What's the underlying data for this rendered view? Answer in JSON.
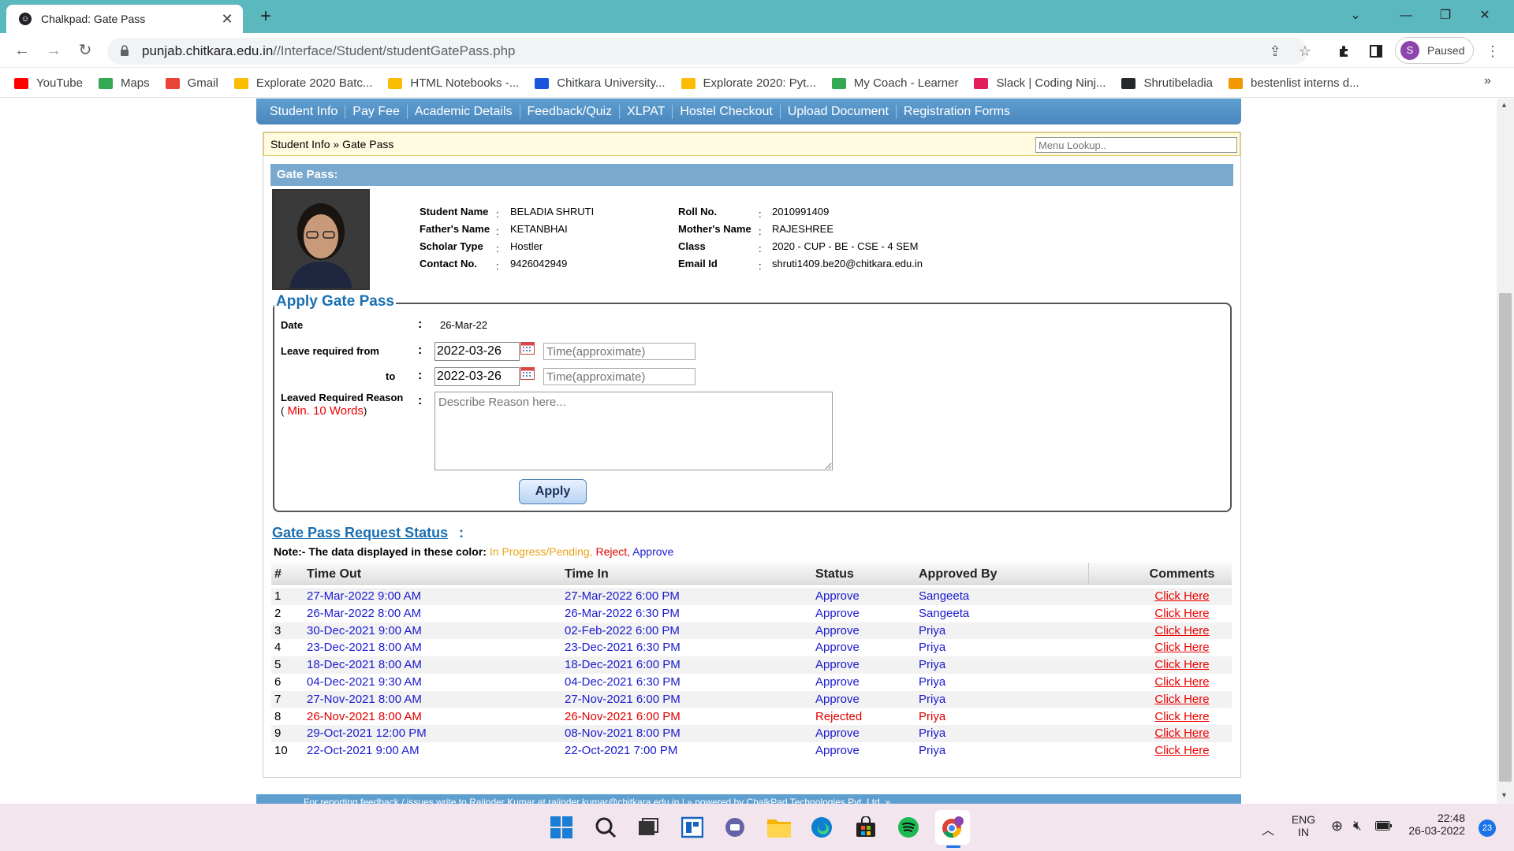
{
  "browser": {
    "tab_title": "Chalkpad: Gate Pass",
    "url_host": "punjab.chitkara.edu.in",
    "url_path": "//Interface/Student/studentGatePass.php",
    "profile_initial": "S",
    "profile_status": "Paused",
    "bookmarks": [
      {
        "label": "YouTube",
        "icon": "youtube-icon",
        "color": "#ff0000"
      },
      {
        "label": "Maps",
        "icon": "maps-icon",
        "color": "#34a853"
      },
      {
        "label": "Gmail",
        "icon": "gmail-icon",
        "color": "#ea4335"
      },
      {
        "label": "Explorate 2020 Batc...",
        "icon": "drive-icon",
        "color": "#fbbc04"
      },
      {
        "label": "HTML Notebooks -...",
        "icon": "drive-icon",
        "color": "#fbbc04"
      },
      {
        "label": "Chitkara University...",
        "icon": "chitkara-icon",
        "color": "#1a56db"
      },
      {
        "label": "Explorate 2020: Pyt...",
        "icon": "drive-icon",
        "color": "#fbbc04"
      },
      {
        "label": "My Coach - Learner",
        "icon": "coach-icon",
        "color": "#34a853"
      },
      {
        "label": "Slack | Coding Ninj...",
        "icon": "slack-icon",
        "color": "#e01e5a"
      },
      {
        "label": "Shrutibeladia",
        "icon": "github-icon",
        "color": "#24292e"
      },
      {
        "label": "bestenlist interns d...",
        "icon": "bookmark-icon",
        "color": "#f29900"
      }
    ]
  },
  "menu": [
    "Student Info",
    "Pay Fee",
    "Academic Details",
    "Feedback/Quiz",
    "XLPAT",
    "Hostel Checkout",
    "Upload Document",
    "Registration Forms"
  ],
  "breadcrumb": "Student Info » Gate Pass",
  "menu_lookup_placeholder": "Menu Lookup..",
  "gatepass_header": "Gate Pass:",
  "student": {
    "left": [
      {
        "label": "Student Name",
        "value": "BELADIA SHRUTI"
      },
      {
        "label": "Father's Name",
        "value": "KETANBHAI"
      },
      {
        "label": "Scholar Type",
        "value": "Hostler"
      },
      {
        "label": "Contact No.",
        "value": "9426042949"
      }
    ],
    "right": [
      {
        "label": "Roll No.",
        "value": "2010991409"
      },
      {
        "label": "Mother's Name",
        "value": "RAJESHREE"
      },
      {
        "label": "Class",
        "value": "2020 - CUP - BE - CSE - 4 SEM"
      },
      {
        "label": "Email Id",
        "value": "shruti1409.be20@chitkara.edu.in"
      }
    ]
  },
  "form": {
    "legend": "Apply Gate Pass",
    "date_label": "Date",
    "date_value": "26-Mar-22",
    "from_label": "Leave required from",
    "from_date": "2022-03-26",
    "to_label": "to",
    "to_date": "2022-03-26",
    "time_placeholder": "Time(approximate)",
    "reason_label": "Leaved Required Reason",
    "reason_hint_open": "(",
    "reason_hint": "Min. 10 Words",
    "reason_hint_close": ")",
    "reason_placeholder": "Describe Reason here...",
    "apply_label": "Apply"
  },
  "status": {
    "title": "Gate Pass Request Status",
    "colon": ":",
    "note_prefix": "Note:- The data displayed in these color:",
    "note_pending": "In Progress/Pending,",
    "note_reject": "Reject,",
    "note_approve": "Approve",
    "colors": {
      "pending": "#e8a317",
      "reject": "#e00000",
      "approve": "#1a1ad0"
    },
    "columns": [
      "#",
      "Time Out",
      "Time In",
      "Status",
      "Approved By",
      "Comments"
    ],
    "rows": [
      {
        "n": "1",
        "out": "27-Mar-2022 9:00 AM",
        "in": "27-Mar-2022 6:00 PM",
        "status": "Approve",
        "by": "Sangeeta",
        "comment": "Click Here",
        "state": "approve"
      },
      {
        "n": "2",
        "out": "26-Mar-2022 8:00 AM",
        "in": "26-Mar-2022 6:30 PM",
        "status": "Approve",
        "by": "Sangeeta",
        "comment": "Click Here",
        "state": "approve"
      },
      {
        "n": "3",
        "out": "30-Dec-2021 9:00 AM",
        "in": "02-Feb-2022 6:00 PM",
        "status": "Approve",
        "by": "Priya",
        "comment": "Click Here",
        "state": "approve"
      },
      {
        "n": "4",
        "out": "23-Dec-2021 8:00 AM",
        "in": "23-Dec-2021 6:30 PM",
        "status": "Approve",
        "by": "Priya",
        "comment": "Click Here",
        "state": "approve"
      },
      {
        "n": "5",
        "out": "18-Dec-2021 8:00 AM",
        "in": "18-Dec-2021 6:00 PM",
        "status": "Approve",
        "by": "Priya",
        "comment": "Click Here",
        "state": "approve"
      },
      {
        "n": "6",
        "out": "04-Dec-2021 9:30 AM",
        "in": "04-Dec-2021 6:30 PM",
        "status": "Approve",
        "by": "Priya",
        "comment": "Click Here",
        "state": "approve"
      },
      {
        "n": "7",
        "out": "27-Nov-2021 8:00 AM",
        "in": "27-Nov-2021 6:00 PM",
        "status": "Approve",
        "by": "Priya",
        "comment": "Click Here",
        "state": "approve"
      },
      {
        "n": "8",
        "out": "26-Nov-2021 8:00 AM",
        "in": "26-Nov-2021 6:00 PM",
        "status": "Rejected",
        "by": "Priya",
        "comment": "Click Here",
        "state": "reject"
      },
      {
        "n": "9",
        "out": "29-Oct-2021 12:00 PM",
        "in": "08-Nov-2021 8:00 PM",
        "status": "Approve",
        "by": "Priya",
        "comment": "Click Here",
        "state": "approve"
      },
      {
        "n": "10",
        "out": "22-Oct-2021 9:00 AM",
        "in": "22-Oct-2021 7:00 PM",
        "status": "Approve",
        "by": "Priya",
        "comment": "Click Here",
        "state": "approve"
      }
    ]
  },
  "footer_text": "For reporting feedback / issues write to Rajinder Kumar at rajinder.kumar@chitkara.edu.in | » powered by ChalkPad Technologies Pvt. Ltd. »",
  "taskbar": {
    "apps": [
      "windows-start-icon",
      "search-icon",
      "task-view-icon",
      "widgets-icon",
      "teams-chat-icon",
      "file-explorer-icon",
      "edge-icon",
      "store-icon",
      "spotify-icon",
      "chrome-icon"
    ],
    "lang_top": "ENG",
    "lang_bottom": "IN",
    "time": "22:48",
    "date": "26-03-2022",
    "notification_count": "23"
  }
}
